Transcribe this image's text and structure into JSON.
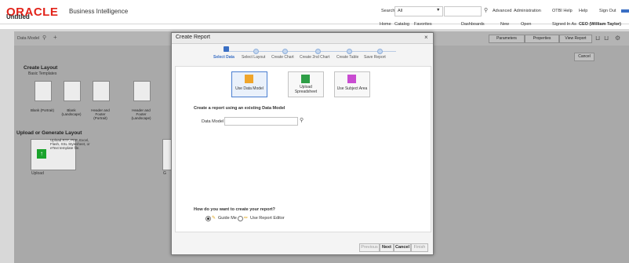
{
  "header": {
    "brand": "ORACLE",
    "product": "Business Intelligence",
    "search_label": "Search",
    "search_scope": "All",
    "links": [
      "Advanced",
      "Administration",
      "OTBI Help",
      "Help",
      "Sign Out"
    ],
    "page_title": "Untitled",
    "nav": [
      "Home",
      "Catalog",
      "Favorites",
      "Dashboards",
      "New",
      "Open",
      "Signed In As",
      "CEO (William Taylor)"
    ]
  },
  "toolbar": {
    "data_model_label": "Data Model",
    "right_buttons": [
      "Parameters",
      "Properties",
      "View Report"
    ],
    "cancel_label": "Cancel"
  },
  "layout_panel": {
    "create_layout_heading": "Create Layout",
    "basic_templates_heading": "Basic Templates",
    "templates": [
      "Blank (Portrait)",
      "Blank (Landscape)",
      "Header and Footer (Portrait)",
      "Header and Footer (Landscape)"
    ],
    "upload_heading": "Upload or Generate Layout",
    "upload_text": "Upload RTF, PDF, Excel, Flash, XSL Stylesheet, or eText template file.",
    "upload_label": "Upload",
    "generate_label": "G"
  },
  "modal": {
    "title": "Create Report",
    "close": "×",
    "steps": [
      "Select Data",
      "Select Layout",
      "Create Chart",
      "Create 2nd Chart",
      "Create Table",
      "Save Report"
    ],
    "sources": [
      "Use Data Model",
      "Upload Spreadsheet",
      "Use Subject Area"
    ],
    "existing_prompt": "Create a report using an existing Data Model",
    "data_model_field_label": "Data Model",
    "data_model_value": "",
    "how_prompt": "How do you want to create your report?",
    "options": [
      "Guide Me",
      "Use Report Editor"
    ],
    "footer_buttons": [
      "Previous",
      "Next",
      "Cancel",
      "Finish"
    ]
  },
  "colors": {
    "brand_red": "#e2231a",
    "accent_blue": "#3a6fc4"
  }
}
